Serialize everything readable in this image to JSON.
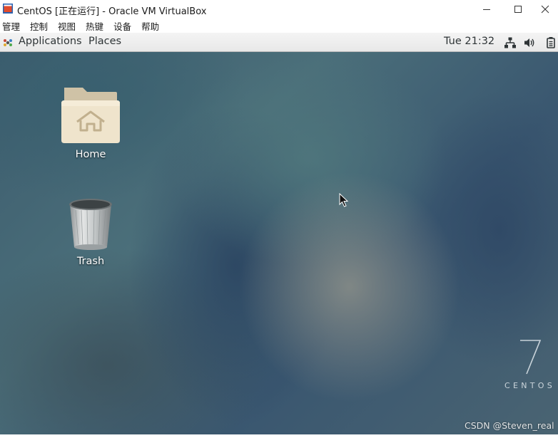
{
  "window": {
    "title": "CentOS [正在运行] - Oracle VM VirtualBox",
    "icon": "virtualbox-icon",
    "controls": [
      "minimize-icon",
      "maximize-icon",
      "close-icon"
    ]
  },
  "menubar": {
    "items": [
      "管理",
      "控制",
      "视图",
      "热键",
      "设备",
      "帮助"
    ]
  },
  "topbar": {
    "applications_label": "Applications",
    "places_label": "Places",
    "clock": "Tue 21:32",
    "tray_icons": [
      "network-icon",
      "volume-icon",
      "power-icon"
    ]
  },
  "desktop": {
    "icons": [
      {
        "label": "Home",
        "icon": "home-folder-icon"
      },
      {
        "label": "Trash",
        "icon": "trash-icon"
      }
    ],
    "branding": {
      "version": "7",
      "name": "CENTOS"
    },
    "watermark": "CSDN @Steven_real"
  }
}
